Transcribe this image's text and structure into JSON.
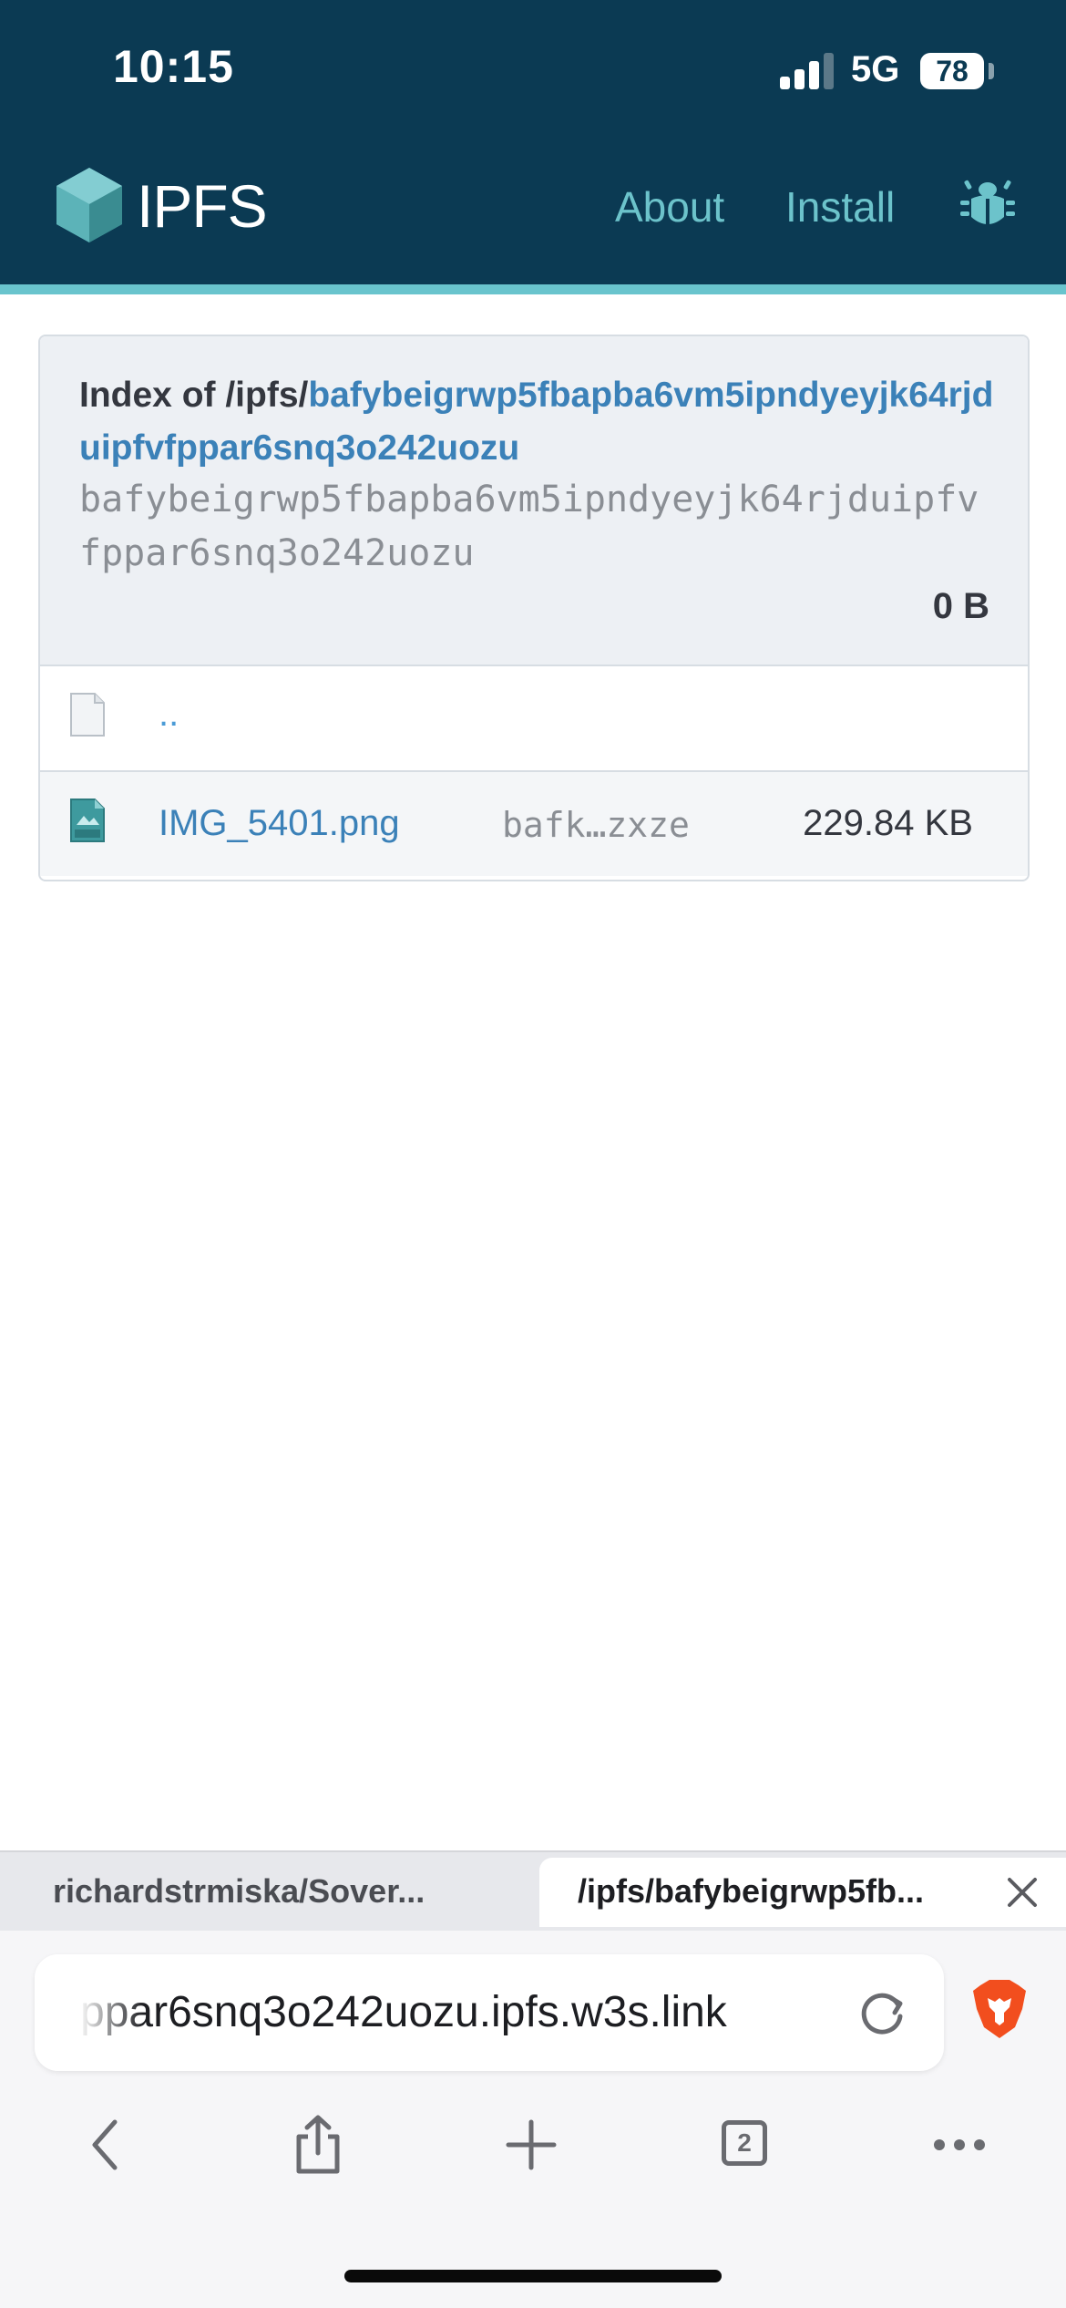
{
  "status_bar": {
    "time": "10:15",
    "network": "5G",
    "battery": "78"
  },
  "header": {
    "logo_text": "IPFS",
    "nav": {
      "about": "About",
      "install": "Install"
    },
    "colors": {
      "header_bg": "#0b3a53",
      "accent": "#69c4cd"
    }
  },
  "listing": {
    "title_prefix": "Index of /ipfs/",
    "title_cid": "bafybeigrwp5fbapba6vm5ipndyeyjk64rjduipfvfppar6snq3o242uozu",
    "cid": "bafybeigrwp5fbapba6vm5ipndyeyjk64rjduipfvfppar6snq3o242uozu",
    "total_size": "0 B",
    "parent_link": "..",
    "files": [
      {
        "name": "IMG_5401.png",
        "cid_short": "bafk…zxze",
        "size": "229.84 KB",
        "icon": "png-file-icon"
      }
    ]
  },
  "browser": {
    "tabs": {
      "inactive_label": "richardstrmiska/Sover...",
      "active_label": "/ipfs/bafybeigrwp5fb..."
    },
    "url_text": "ppar6snq3o242uozu.ipfs.w3s.link",
    "open_tab_count": "2"
  }
}
